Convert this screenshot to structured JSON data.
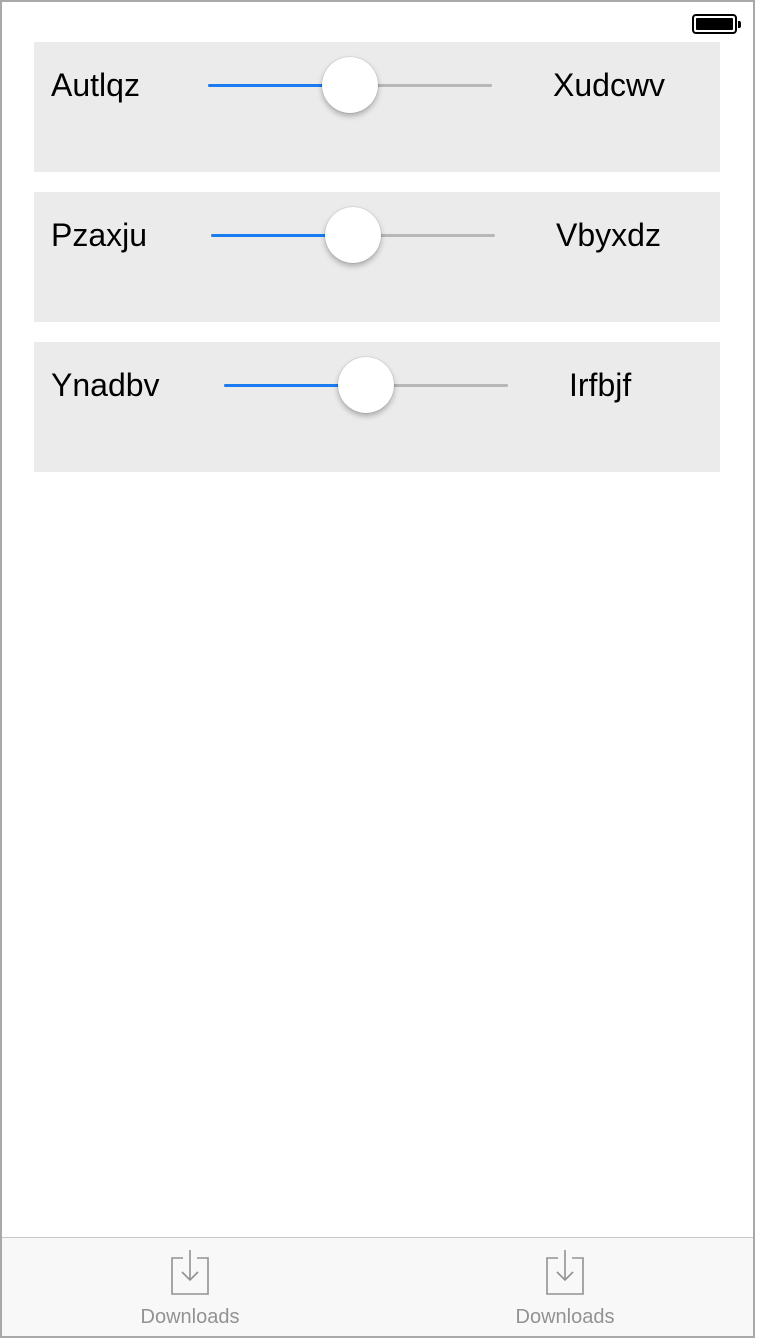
{
  "status_bar": {
    "battery_icon": "battery-full-icon"
  },
  "sliders": [
    {
      "left_label": "Autlqz",
      "right_label": "Xudcwv",
      "value": 0.5
    },
    {
      "left_label": "Pzaxju",
      "right_label": "Vbyxdz",
      "value": 0.5
    },
    {
      "left_label": "Ynadbv",
      "right_label": "Irfbjf",
      "value": 0.5
    }
  ],
  "tab_bar": {
    "items": [
      {
        "label": "Downloads",
        "icon": "download-icon"
      },
      {
        "label": "Downloads",
        "icon": "download-icon"
      }
    ]
  },
  "colors": {
    "accent": "#1a7cf2",
    "track": "#b7b7b7",
    "panel": "#ebebeb",
    "tab_label": "#929292"
  }
}
